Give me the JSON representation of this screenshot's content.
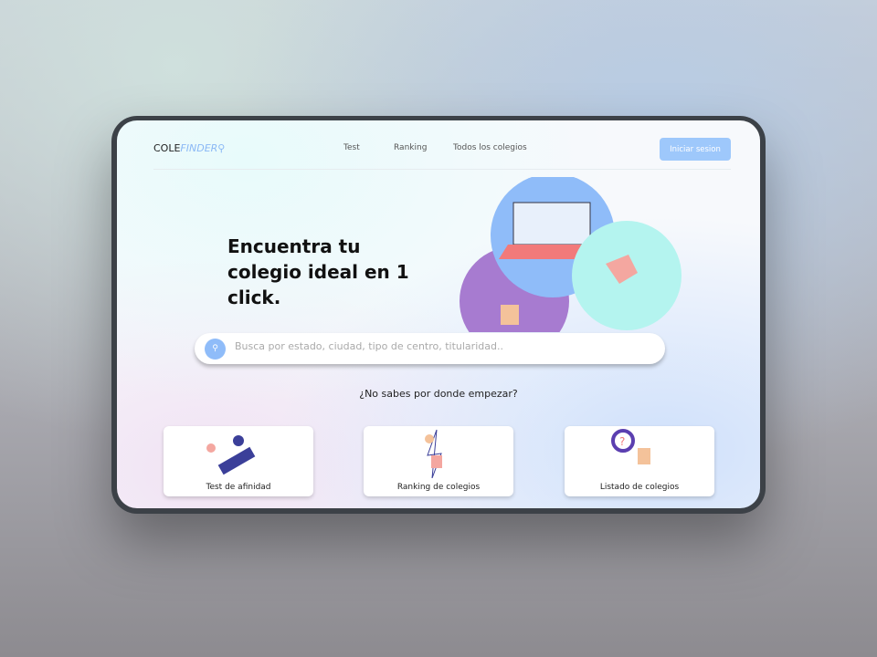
{
  "nav": {
    "logo_prefix": "COLE",
    "logo_suffix": "FINDER",
    "links": [
      "Test",
      "Ranking",
      "Todos los colegios"
    ],
    "login": "Iniciar sesion"
  },
  "hero": {
    "title": "Encuentra tu colegio ideal en 1 click."
  },
  "search": {
    "placeholder": "Busca por estado, ciudad, tipo de centro, titularidad..",
    "icon": "search-icon"
  },
  "prompt": "¿No sabes por donde empezar?",
  "cards": [
    {
      "label": "Test de afinidad"
    },
    {
      "label": "Ranking de colegios"
    },
    {
      "label": "Listado de colegios"
    }
  ],
  "colors": {
    "accent": "#9ec8fb",
    "purple": "#a77bd0",
    "teal": "#b4f4ef",
    "blue": "#8fbcf9"
  }
}
